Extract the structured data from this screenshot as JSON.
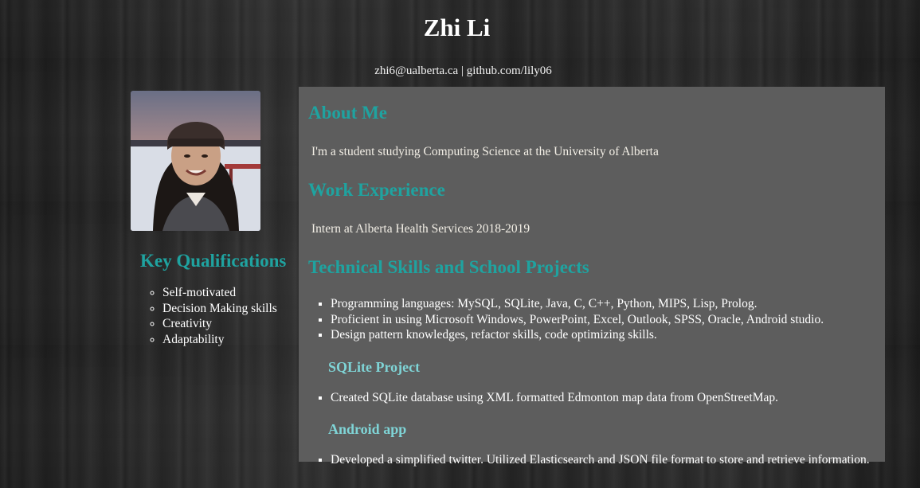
{
  "header": {
    "name": "Zhi Li",
    "contact": "zhi6@ualberta.ca | github.com/lily06"
  },
  "profile_photo": {
    "icon": "portrait-photo"
  },
  "key_qualifications": {
    "title": "Key Qualifications",
    "items": [
      "Self-motivated",
      "Decision Making skills",
      "Creativity",
      "Adaptability"
    ]
  },
  "about": {
    "title": "About Me",
    "text": "I'm a student studying Computing Science at the University of Alberta"
  },
  "work": {
    "title": "Work Experience",
    "text": "Intern at Alberta Health Services 2018-2019"
  },
  "skills": {
    "title": "Technical Skills and School Projects",
    "items": [
      "Programming languages: MySQL, SQLite, Java, C, C++, Python, MIPS, Lisp, Prolog.",
      "Proficient in using Microsoft Windows, PowerPoint, Excel, Outlook, SPSS, Oracle, Android studio.",
      "Design pattern knowledges, refactor skills, code optimizing skills."
    ]
  },
  "projects": [
    {
      "title": "SQLite Project",
      "items": [
        "Created SQLite database using XML formatted Edmonton map data from OpenStreetMap."
      ]
    },
    {
      "title": "Android app",
      "items": [
        "Developed a simplified twitter. Utilized Elasticsearch and JSON file format to store and retrieve information."
      ]
    }
  ],
  "colors": {
    "heading_teal": "#1fa3a0",
    "subheading_teal": "#7fd4d6",
    "panel_gray": "#5d5d5d",
    "background": "#262626"
  }
}
